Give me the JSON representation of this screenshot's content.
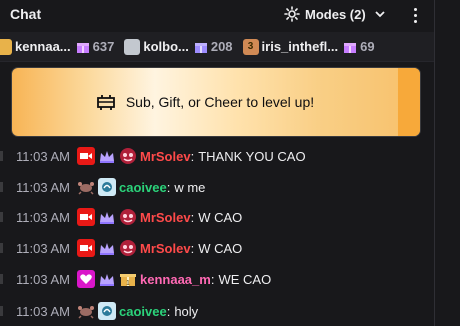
{
  "header": {
    "title": "Chat",
    "modes_label": "Modes (2)"
  },
  "leaderboard": [
    {
      "name": "kennaa...",
      "count": "637",
      "rank_color": "#e8b24a",
      "rank": ""
    },
    {
      "name": "kolbo...",
      "count": "208",
      "rank_color": "#c3c8cf",
      "rank": ""
    },
    {
      "name": "iris_inthefl...",
      "count": "69",
      "rank_color": "#d18a55",
      "rank": "3"
    }
  ],
  "level_up": {
    "label": "Sub, Gift, or Cheer to level up!"
  },
  "messages": [
    {
      "time": "11:03 AM",
      "user": "MrSolev",
      "text": "THANK YOU CAO",
      "color": "#ff4a4a",
      "badges": [
        "video-badge",
        "crown-badge",
        "mask-badge"
      ]
    },
    {
      "time": "11:03 AM",
      "user": "caoivee",
      "text": "w me",
      "color": "#2bd27a",
      "badges": [
        "crab-badge",
        "sub-badge"
      ]
    },
    {
      "time": "11:03 AM",
      "user": "MrSolev",
      "text": "W CAO",
      "color": "#ff4a4a",
      "badges": [
        "video-badge",
        "crown-badge",
        "mask-badge"
      ]
    },
    {
      "time": "11:03 AM",
      "user": "MrSolev",
      "text": "W CAO",
      "color": "#ff4a4a",
      "badges": [
        "video-badge",
        "crown-badge",
        "mask-badge"
      ]
    },
    {
      "time": "11:03 AM",
      "user": "kennaaa_m",
      "text": "WE CAO",
      "color": "#ff69b4",
      "badges": [
        "heart-badge",
        "crown-badge",
        "gift-badge"
      ]
    },
    {
      "time": "11:03 AM",
      "user": "caoivee",
      "text": "holy",
      "color": "#2bd27a",
      "badges": [
        "crab-badge",
        "sub-badge"
      ]
    }
  ]
}
